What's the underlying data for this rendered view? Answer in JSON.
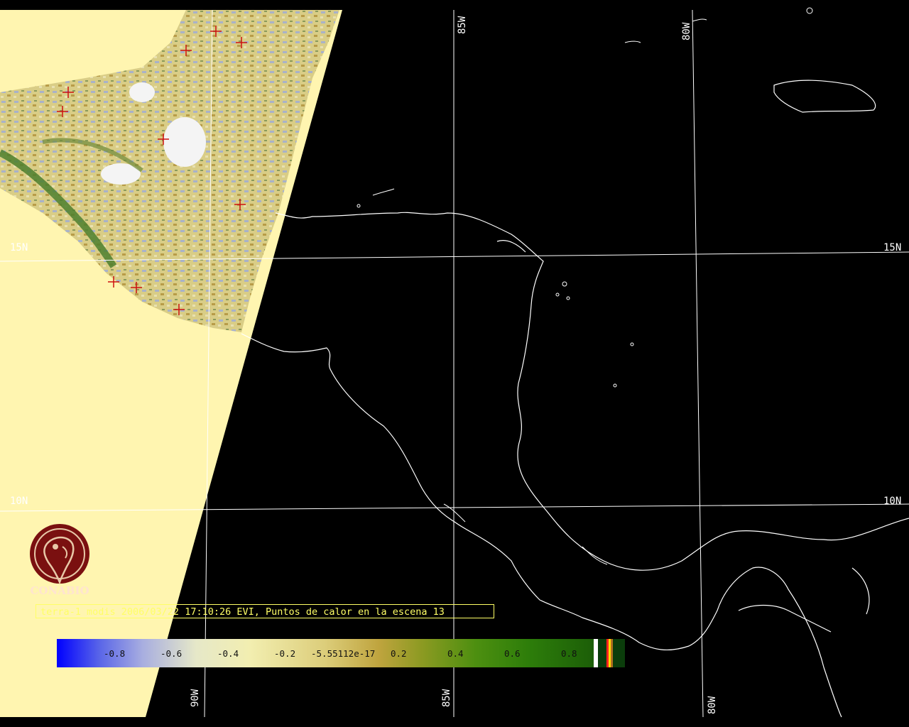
{
  "grid_labels": {
    "lat_15_left": "15N",
    "lat_15_right": "15N",
    "lat_10_left": "10N",
    "lat_10_right": "10N",
    "lon_85_top": "85W",
    "lon_80_top": "80W",
    "lon_90_bottom": "90W",
    "lon_85_bottom": "85W",
    "lon_80_bottom": "80W"
  },
  "logo": {
    "text": "CONABIO",
    "icon": "conabio-macaw-logo-icon"
  },
  "caption": "terra-1 modis 2006/03/22 17:10:26 EVI, Puntos de calor en la escena 13",
  "colorbar": {
    "ticks": [
      "-0.8",
      "-0.6",
      "-0.4",
      "-0.2",
      "-5.55112e-17",
      "0.2",
      "0.4",
      "0.6",
      "0.8"
    ]
  },
  "colors": {
    "background": "#000000",
    "no_data": "#fff5b0",
    "coastline": "#ffffff",
    "grid": "#ffffff",
    "hotspot": "#cc1111",
    "caption": "#ffff66"
  },
  "hotspot_marker": "red-cross-icon"
}
